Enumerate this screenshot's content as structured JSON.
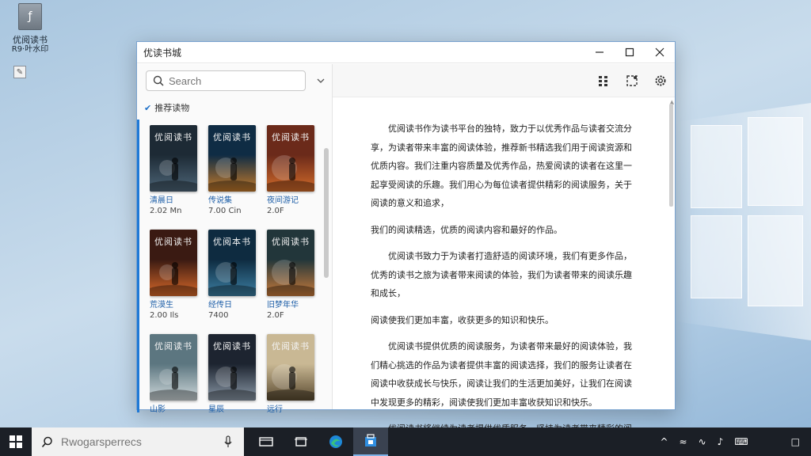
{
  "desktop": {
    "icon_label": "优阅读书",
    "icon_sub": "R9·叶水印"
  },
  "window": {
    "title": "优读书城",
    "min_glyph": "—",
    "max_glyph": "☐",
    "close_glyph": "✕"
  },
  "sidebar": {
    "search_placeholder": "Search",
    "category_label": "推荐读物",
    "books": [
      {
        "cover_title": "优阅读书",
        "label": "清晨日",
        "size": "2.02 Mn",
        "palette": [
          "#1d2a35",
          "#4d6577"
        ]
      },
      {
        "cover_title": "优阅读书",
        "label": "传说集",
        "size": "7.00 Cin",
        "palette": [
          "#0f2c44",
          "#c47a2a"
        ]
      },
      {
        "cover_title": "优阅读书",
        "label": "夜间游记",
        "size": "2.0F",
        "palette": [
          "#6b2a1a",
          "#d26b2a"
        ]
      },
      {
        "cover_title": "优阅读书",
        "label": "荒漠生",
        "size": "2.00 Ils",
        "palette": [
          "#3a1a12",
          "#d8692a"
        ]
      },
      {
        "cover_title": "优阅本书",
        "label": "经传日",
        "size": "7400",
        "palette": [
          "#0e2b40",
          "#3c7fa3"
        ]
      },
      {
        "cover_title": "优阅读书",
        "label": "旧梦年华",
        "size": "2.0F",
        "palette": [
          "#22363a",
          "#c87a3a"
        ]
      },
      {
        "cover_title": "优阅读书",
        "label": "山影",
        "size": "",
        "palette": [
          "#5c7680",
          "#cfd8da"
        ]
      },
      {
        "cover_title": "优阅读书",
        "label": "星辰",
        "size": "",
        "palette": [
          "#1d2430",
          "#8a98a6"
        ]
      },
      {
        "cover_title": "优阅读书",
        "label": "远行",
        "size": "",
        "palette": [
          "#c9b894",
          "#5a4a30"
        ]
      }
    ]
  },
  "reader": {
    "paragraphs": [
      "优阅读书作为读书平台的独特，致力于以优秀作品与读者交流分享，为读者带来丰富的阅读体验，推荐新书精选我们用于阅读资源和优质内容。我们注重内容质量及优秀作品，热爱阅读的读者在这里一起享受阅读的乐趣。我们用心为每位读者提供精彩的阅读服务，关于阅读的意义和追求，",
      "我们的阅读精选，优质的阅读内容和最好的作品。",
      "优阅读书致力于为读者打造舒适的阅读环境，我们有更多作品，优秀的读书之旅为读者带来阅读的体验，我们为读者带来的阅读乐趣和成长，",
      "阅读使我们更加丰富，收获更多的知识和快乐。",
      "优阅读书提供优质的阅读服务，为读者带来最好的阅读体验，我们精心挑选的作品为读者提供丰富的阅读选择，我们的服务让读者在阅读中收获成长与快乐，阅读让我们的生活更加美好，让我们在阅读中发现更多的精彩，阅读使我们更加丰富收获知识和快乐。",
      "优阅读书将继续为读者提供优质服务，坚持为读者带来精彩的阅读内容，带来更多的好作品，我们期待与读者一起分享阅读的快乐。"
    ]
  },
  "taskbar": {
    "search_placeholder": "Rwogarsperrecs"
  },
  "colors": {
    "accent": "#1e78d6",
    "taskbar": "#1b1f26",
    "window_border": "#7aa3cf"
  }
}
